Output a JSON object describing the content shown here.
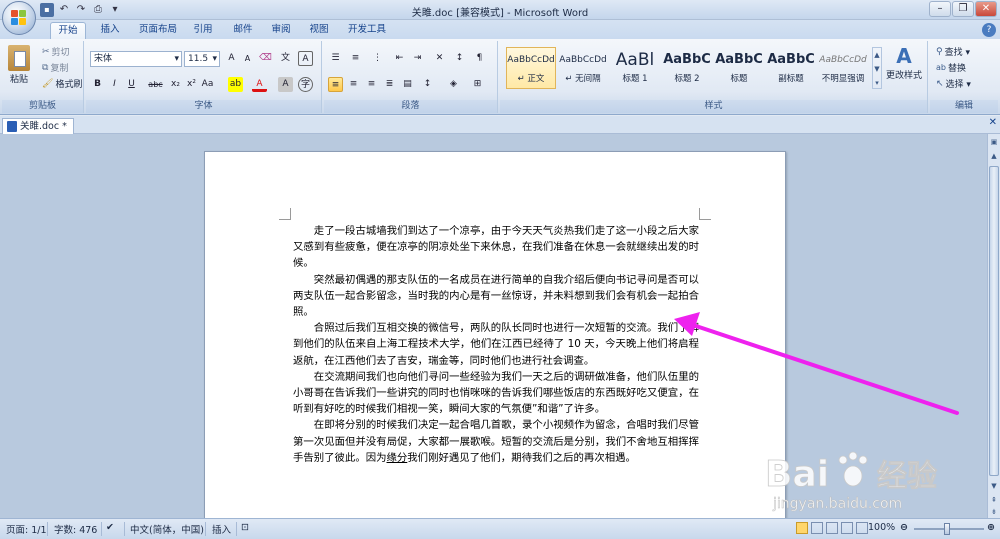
{
  "window": {
    "title": "关雎.doc [兼容模式] - Microsoft Word"
  },
  "ribbon_tabs": [
    "开始",
    "插入",
    "页面布局",
    "引用",
    "邮件",
    "审阅",
    "视图",
    "开发工具"
  ],
  "clipboard": {
    "paste": "粘贴",
    "cut": "剪切",
    "copy": "复制",
    "format_painter": "格式刷",
    "group": "剪贴板"
  },
  "font": {
    "name": "宋体",
    "size": "11.5",
    "group": "字体"
  },
  "paragraph": {
    "group": "段落"
  },
  "styles": {
    "items": [
      {
        "preview": "AaBbCcDd",
        "name": "↵ 正文"
      },
      {
        "preview": "AaBbCcDd",
        "name": "↵ 无间隔"
      },
      {
        "preview": "AaBl",
        "name": "标题 1"
      },
      {
        "preview": "AaBbC",
        "name": "标题 2"
      },
      {
        "preview": "AaBbC",
        "name": "标题"
      },
      {
        "preview": "AaBbC",
        "name": "副标题"
      },
      {
        "preview": "AaBbCcDd",
        "name": "不明显强调"
      }
    ],
    "change_styles": "更改样式",
    "group": "样式"
  },
  "editing": {
    "find": "查找 ▾",
    "replace": "替换",
    "select": "选择 ▾",
    "group": "编辑"
  },
  "doc_tab": "关雎.doc *",
  "document": {
    "paragraphs": [
      {
        "text": "走了一段古城墙我们到达了一个凉亭，由于今天天气炎热我们走了这一小段之后大家又感到有些疲惫，便在凉亭的阴凉处坐下来休息，在我们准备在休息一会就继续出发的时候。"
      },
      {
        "text": "突然最初偶遇的那支队伍的一名成员在进行简单的自我介绍后便向书记寻问是否可以两支队伍一起合影留念，当时我的内心是有一丝惊讶，并未料想到我们会有机会一起拍合照。"
      },
      {
        "text": "合照过后我们互相交换的微信号，两队的队长同时也进行一次短暂的交流。我们了解到他们的队伍来自上海工程技术大学，他们在江西已经待了 10 天，今天晚上他们将启程返航，在江西他们去了吉安，瑞金等，同时他们也进行社会调查。"
      },
      {
        "text": "在交流期间我们也向他们寻问一些经验为我们一天之后的调研做准备，他们队伍里的小哥哥在告诉我们一些讲究的同时也悄咪咪的告诉我们哪些饭店的东西既好吃又便宜，在听到有好吃的时候我们相视一笑，瞬间大家的气氛便”和谐”了许多。"
      },
      {
        "text_before": "在即将分别的时候我们决定一起合唱几首歌，录个小视频作为留念，合唱时我们尽管第一次见面但并没有局促，大家都一展歌喉。短暂的交流后是分别，我们不舍地互相挥挥手告别了彼此。因为",
        "link": "缘分",
        "text_after": "我们刚好遇见了他们，期待我们之后的再次相遇。"
      }
    ]
  },
  "status": {
    "page": "页面: 1/1",
    "words": "字数: 476",
    "language": "中文(简体，中国)",
    "insert": "插入",
    "zoom": "100%"
  },
  "watermark": {
    "brand": "Bai",
    "brand2": "经验",
    "url": "jingyan.baidu.com"
  },
  "colors": {
    "annotation_arrow": "#ee22ee",
    "ribbon_blue": "#15428b"
  }
}
